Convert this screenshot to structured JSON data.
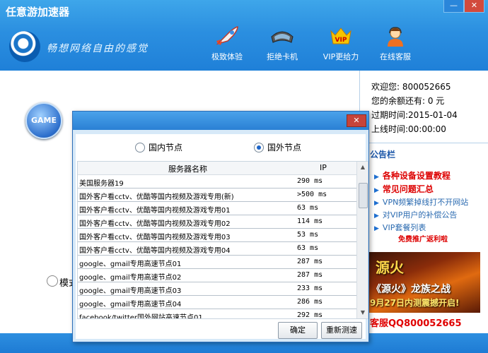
{
  "app": {
    "title": "任意游加速器",
    "slogan": "畅想网络自由的感觉"
  },
  "window_controls": {
    "minimize": "—",
    "close": "✕"
  },
  "nav": [
    {
      "label": "极致体验",
      "icon": "rocket-icon"
    },
    {
      "label": "拒绝卡机",
      "icon": "goggles-icon"
    },
    {
      "label": "VIP更给力",
      "icon": "vip-icon"
    },
    {
      "label": "在线客服",
      "icon": "support-agent-icon"
    }
  ],
  "game_badge": "GAME",
  "mode_label": "模式",
  "user": {
    "welcome": "欢迎您: 800052665",
    "balance": "您的余额还有: 0 元",
    "expire": "过期时间:2015-01-04",
    "online": "上线时间:00:00:00"
  },
  "notice": {
    "title": "公告栏",
    "hot_items": [
      "各种设备设置教程",
      "常见问题汇总"
    ],
    "items": [
      "VPN频繁掉线打不开网站",
      "对VIP用户的补偿公告",
      "VIP套餐列表"
    ],
    "promo": "免费推广返利啦",
    "banner": {
      "title": "源火",
      "subtitle": "《源火》龙族之战",
      "date": "9月27日内测震撼开启!"
    },
    "qq": "客服QQ800052665"
  },
  "dialog": {
    "options": [
      {
        "label": "国内节点",
        "selected": false
      },
      {
        "label": "国外节点",
        "selected": true
      }
    ],
    "columns": {
      "name": "服务器名称",
      "ip": "IP"
    },
    "rows": [
      {
        "name": "美国服务器19",
        "ping": "290 ms"
      },
      {
        "name": "国外客户看cctv、优酷等国内视频及游戏专用(新)",
        "ping": ">500 ms"
      },
      {
        "name": "国外客户看cctv、优酷等国内视频及游戏专用01",
        "ping": "63 ms"
      },
      {
        "name": "国外客户看cctv、优酷等国内视频及游戏专用02",
        "ping": "114 ms"
      },
      {
        "name": "国外客户看cctv、优酷等国内视频及游戏专用03",
        "ping": "53 ms"
      },
      {
        "name": "国外客户看cctv、优酷等国内视频及游戏专用04",
        "ping": "63 ms"
      },
      {
        "name": "google、gmail专用高速节点01",
        "ping": "287 ms"
      },
      {
        "name": "google、gmail专用高速节点02",
        "ping": "287 ms"
      },
      {
        "name": "google、gmail专用高速节点03",
        "ping": "233 ms"
      },
      {
        "name": "google、gmail专用高速节点04",
        "ping": "286 ms"
      },
      {
        "name": "facebook/twitter国外网站高速节点01",
        "ping": "292 ms"
      }
    ],
    "confirm": "确定",
    "retest": "重新测速"
  },
  "colors": {
    "header_blue": "#2b8fe0",
    "accent_red": "#e00000",
    "dialog_bg": "#d7e9f8"
  }
}
